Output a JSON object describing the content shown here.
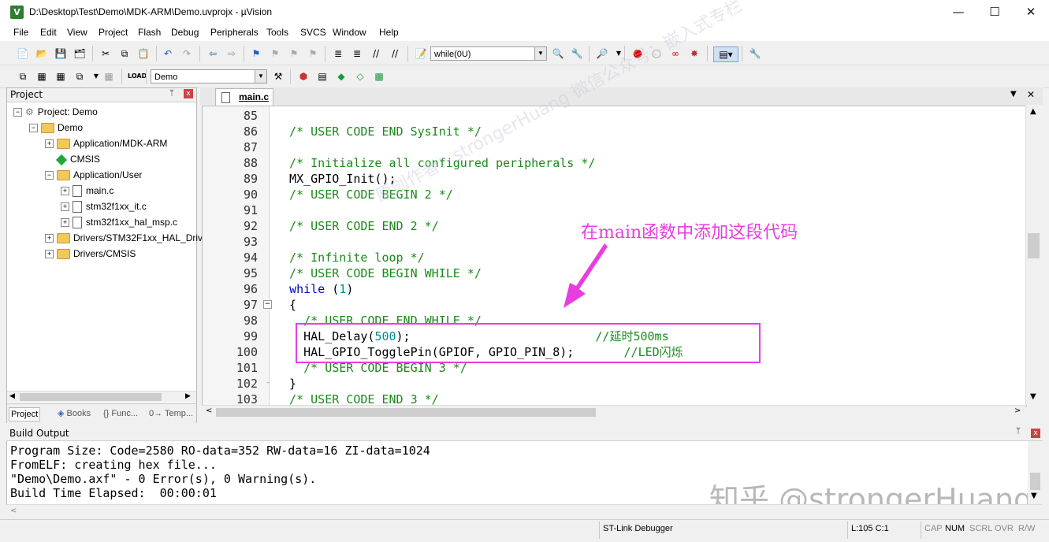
{
  "window": {
    "title": "D:\\Desktop\\Test\\Demo\\MDK-ARM\\Demo.uvprojx - µVision",
    "app_icon": "V",
    "minimize": "—",
    "maximize": "☐",
    "close": "✕"
  },
  "menu": [
    "File",
    "Edit",
    "View",
    "Project",
    "Flash",
    "Debug",
    "Peripherals",
    "Tools",
    "SVCS",
    "Window",
    "Help"
  ],
  "toolbar1": {
    "find_combo_value": "while(0U)"
  },
  "toolbar2": {
    "target_combo_value": "Demo"
  },
  "project_panel": {
    "title": "Project",
    "pin": "ᛘ",
    "close": "x",
    "tree": [
      {
        "label": "Project: Demo",
        "expander": "−",
        "kind": "project"
      },
      {
        "label": "Demo",
        "expander": "−",
        "kind": "folder"
      },
      {
        "label": "Application/MDK-ARM",
        "expander": "+",
        "kind": "folder"
      },
      {
        "label": "CMSIS",
        "expander": "",
        "kind": "gem"
      },
      {
        "label": "Application/User",
        "expander": "−",
        "kind": "folder"
      },
      {
        "label": "main.c",
        "expander": "+",
        "kind": "file"
      },
      {
        "label": "stm32f1xx_it.c",
        "expander": "+",
        "kind": "file"
      },
      {
        "label": "stm32f1xx_hal_msp.c",
        "expander": "+",
        "kind": "file"
      },
      {
        "label": "Drivers/STM32F1xx_HAL_Driv",
        "expander": "+",
        "kind": "folder"
      },
      {
        "label": "Drivers/CMSIS",
        "expander": "+",
        "kind": "folder"
      }
    ],
    "tabs": [
      "Project",
      "Books",
      "{} Func...",
      "0→ Temp..."
    ]
  },
  "editor": {
    "tab_label": "main.c",
    "tab_menu": "▼",
    "tab_close": "✕",
    "lines": [
      {
        "n": "85",
        "segs": []
      },
      {
        "n": "86",
        "segs": [
          {
            "t": "  /* USER CODE END SysInit */",
            "c": "cm"
          }
        ]
      },
      {
        "n": "87",
        "segs": []
      },
      {
        "n": "88",
        "segs": [
          {
            "t": "  /* Initialize all configured peripherals */",
            "c": "cm"
          }
        ]
      },
      {
        "n": "89",
        "segs": [
          {
            "t": "  MX_GPIO_Init();",
            "c": ""
          }
        ]
      },
      {
        "n": "90",
        "segs": [
          {
            "t": "  /* USER CODE BEGIN 2 */",
            "c": "cm"
          }
        ]
      },
      {
        "n": "91",
        "segs": []
      },
      {
        "n": "92",
        "segs": [
          {
            "t": "  /* USER CODE END 2 */",
            "c": "cm"
          }
        ]
      },
      {
        "n": "93",
        "segs": []
      },
      {
        "n": "94",
        "segs": [
          {
            "t": "  /* Infinite loop */",
            "c": "cm"
          }
        ]
      },
      {
        "n": "95",
        "segs": [
          {
            "t": "  /* USER CODE BEGIN WHILE */",
            "c": "cm"
          }
        ]
      },
      {
        "n": "96",
        "segs": [
          {
            "t": "  ",
            "c": ""
          },
          {
            "t": "while",
            "c": "kw"
          },
          {
            "t": " (",
            "c": ""
          },
          {
            "t": "1",
            "c": "num"
          },
          {
            "t": ")",
            "c": ""
          }
        ]
      },
      {
        "n": "97",
        "segs": [
          {
            "t": "  {",
            "c": ""
          }
        ]
      },
      {
        "n": "98",
        "segs": [
          {
            "t": "    /* USER CODE END WHILE */",
            "c": "cm"
          }
        ]
      },
      {
        "n": "99",
        "segs": [
          {
            "t": "    HAL_Delay(",
            "c": ""
          },
          {
            "t": "500",
            "c": "num"
          },
          {
            "t": ");",
            "c": ""
          },
          {
            "t": "                          //延时500ms",
            "c": "cm"
          }
        ]
      },
      {
        "n": "100",
        "segs": [
          {
            "t": "    HAL_GPIO_TogglePin(GPIOF, GPIO_PIN_8);",
            "c": ""
          },
          {
            "t": "       //LED闪烁",
            "c": "cm"
          }
        ]
      },
      {
        "n": "101",
        "segs": [
          {
            "t": "    /* USER CODE BEGIN 3 */",
            "c": "cm"
          }
        ]
      },
      {
        "n": "102",
        "segs": [
          {
            "t": "  }",
            "c": ""
          }
        ]
      },
      {
        "n": "103",
        "segs": [
          {
            "t": "  /* USER CODE END 3 */",
            "c": "cm"
          }
        ]
      }
    ]
  },
  "annotation": {
    "text": "在main函数中添加这段代码",
    "color": "#e83ee0",
    "watermark": "原创作者：strongerHuang  微信公众号：嵌入式专栏"
  },
  "build_output": {
    "title": "Build Output",
    "lines": [
      "Program Size: Code=2580 RO-data=352 RW-data=16 ZI-data=1024",
      "FromELF: creating hex file...",
      "\"Demo\\Demo.axf\" - 0 Error(s), 0 Warning(s).",
      "Build Time Elapsed:  00:00:01"
    ],
    "watermark": "知乎 @strongerHuang"
  },
  "status": {
    "debugger": "ST-Link Debugger",
    "position": "L:105 C:1",
    "indicators": [
      "CAP",
      "NUM",
      "SCRL",
      "OVR",
      "R/W"
    ]
  }
}
